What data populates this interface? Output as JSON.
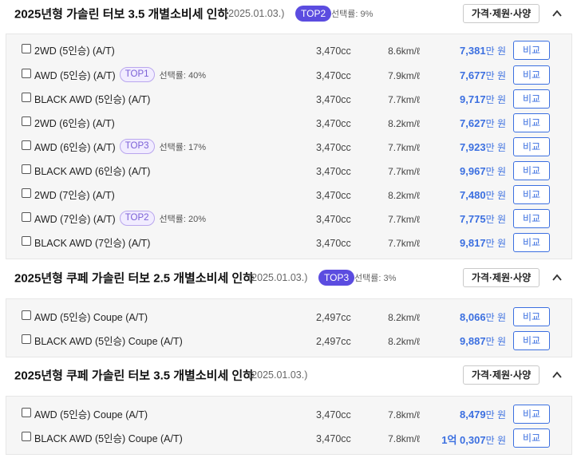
{
  "ui": {
    "spec_button_label": "가격·제원·사양",
    "compare_label": "비교",
    "price_unit": "만 원",
    "rate_prefix": "선택률: "
  },
  "sections": [
    {
      "title": "2025년형 가솔린 터보 3.5 개별소비세 인하",
      "date": "(2025.01.03.)",
      "badge": "TOP2",
      "rate": "선택률: 9%",
      "rows": [
        {
          "name": "2WD (5인승) (A/T)",
          "badge": "",
          "rate": "",
          "displacement": "3,470cc",
          "efficiency": "8.6km/ℓ",
          "price": "7,381",
          "unit": "만 원"
        },
        {
          "name": "AWD (5인승) (A/T)",
          "badge": "TOP1",
          "rate": "선택률: 40%",
          "displacement": "3,470cc",
          "efficiency": "7.9km/ℓ",
          "price": "7,677",
          "unit": "만 원"
        },
        {
          "name": "BLACK AWD (5인승) (A/T)",
          "badge": "",
          "rate": "",
          "displacement": "3,470cc",
          "efficiency": "7.7km/ℓ",
          "price": "9,717",
          "unit": "만 원"
        },
        {
          "name": "2WD (6인승) (A/T)",
          "badge": "",
          "rate": "",
          "displacement": "3,470cc",
          "efficiency": "8.2km/ℓ",
          "price": "7,627",
          "unit": "만 원"
        },
        {
          "name": "AWD (6인승) (A/T)",
          "badge": "TOP3",
          "rate": "선택률: 17%",
          "displacement": "3,470cc",
          "efficiency": "7.7km/ℓ",
          "price": "7,923",
          "unit": "만 원"
        },
        {
          "name": "BLACK AWD (6인승) (A/T)",
          "badge": "",
          "rate": "",
          "displacement": "3,470cc",
          "efficiency": "7.7km/ℓ",
          "price": "9,967",
          "unit": "만 원"
        },
        {
          "name": "2WD (7인승) (A/T)",
          "badge": "",
          "rate": "",
          "displacement": "3,470cc",
          "efficiency": "8.2km/ℓ",
          "price": "7,480",
          "unit": "만 원"
        },
        {
          "name": "AWD (7인승) (A/T)",
          "badge": "TOP2",
          "rate": "선택률: 20%",
          "displacement": "3,470cc",
          "efficiency": "7.7km/ℓ",
          "price": "7,775",
          "unit": "만 원"
        },
        {
          "name": "BLACK AWD (7인승) (A/T)",
          "badge": "",
          "rate": "",
          "displacement": "3,470cc",
          "efficiency": "7.7km/ℓ",
          "price": "9,817",
          "unit": "만 원"
        }
      ]
    },
    {
      "title": "2025년형 쿠페 가솔린 터보 2.5 개별소비세 인하",
      "date": "(2025.01.03.)",
      "badge": "TOP3",
      "rate": "선택률: 3%",
      "rows": [
        {
          "name": "AWD (5인승) Coupe (A/T)",
          "badge": "",
          "rate": "",
          "displacement": "2,497cc",
          "efficiency": "8.2km/ℓ",
          "price": "8,066",
          "unit": "만 원"
        },
        {
          "name": "BLACK AWD (5인승) Coupe (A/T)",
          "badge": "",
          "rate": "",
          "displacement": "2,497cc",
          "efficiency": "8.2km/ℓ",
          "price": "9,887",
          "unit": "만 원"
        }
      ]
    },
    {
      "title": "2025년형 쿠페 가솔린 터보 3.5 개별소비세 인하",
      "date": "(2025.01.03.)",
      "badge": "",
      "rate": "",
      "rows": [
        {
          "name": "AWD (5인승) Coupe (A/T)",
          "badge": "",
          "rate": "",
          "displacement": "3,470cc",
          "efficiency": "7.8km/ℓ",
          "price": "8,479",
          "unit": "만 원"
        },
        {
          "name": "BLACK AWD (5인승) Coupe (A/T)",
          "badge": "",
          "rate": "",
          "displacement": "3,470cc",
          "efficiency": "7.8km/ℓ",
          "price": "1억 0,307",
          "unit": "만 원"
        }
      ]
    }
  ],
  "colors": {
    "accent": "#3b6fe0",
    "badge_solid": "#5b4ce0",
    "badge_outline": "#b9a6ee",
    "panel_bg": "#f6f6f6"
  },
  "icons": {
    "collapse": "chevron-up-icon",
    "checkbox": "checkbox-icon"
  }
}
